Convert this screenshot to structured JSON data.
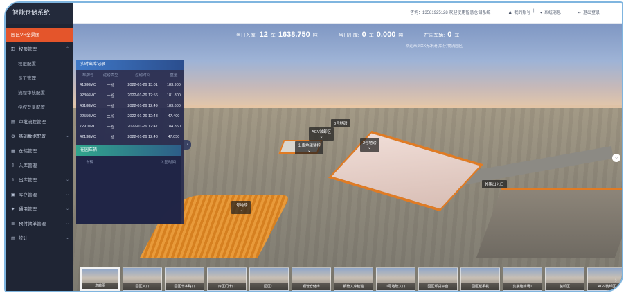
{
  "sidebar": {
    "title": "智能仓储系统",
    "items": [
      {
        "label": "园区VR全景图",
        "icon": "",
        "active": true,
        "sub": false
      },
      {
        "label": "权限管理",
        "icon": "key-icon",
        "sub": false,
        "chevron": "^"
      },
      {
        "label": "权限配置",
        "sub": true
      },
      {
        "label": "员工管理",
        "sub": true
      },
      {
        "label": "流程审核配置",
        "sub": true
      },
      {
        "label": "授权登录配置",
        "sub": true
      },
      {
        "label": "审批流程管理",
        "icon": "doc-icon",
        "sub": false
      },
      {
        "label": "基础数据配置",
        "icon": "gear-icon",
        "sub": false,
        "chevron": "v"
      },
      {
        "label": "仓储管理",
        "icon": "grid-icon",
        "sub": false
      },
      {
        "label": "入库管理",
        "icon": "inbox-icon",
        "sub": false
      },
      {
        "label": "出库管理",
        "icon": "outbox-icon",
        "sub": false,
        "chevron": "v"
      },
      {
        "label": "库存管理",
        "icon": "box-icon",
        "sub": false,
        "chevron": "v"
      },
      {
        "label": "通用管理",
        "icon": "tool-icon",
        "sub": false,
        "chevron": "v"
      },
      {
        "label": "预付款单管理",
        "icon": "list-icon",
        "sub": false,
        "chevron": "v"
      },
      {
        "label": "统计",
        "icon": "chart-icon",
        "sub": false,
        "chevron": "v"
      }
    ]
  },
  "topbar": {
    "phone": "咨询：13581925128 欢迎使用智慧仓储系统",
    "account": "我的账号",
    "separator": "|",
    "messages": "系统消息",
    "logout": "退出登录"
  },
  "stats": {
    "in_label": "当日入库:",
    "in_count": "12",
    "in_unit_vehicle": "车",
    "in_weight": "1638.750",
    "in_unit_weight": "吨",
    "out_label": "当日出库:",
    "out_count": "0",
    "out_unit_vehicle": "车",
    "out_weight": "0.000",
    "out_unit_weight": "吨",
    "park_label": "在园车辆:",
    "park_count": "0",
    "park_unit": "车",
    "welcome": "欢迎来到XX无水港(库存)物流园区"
  },
  "inbound_panel": {
    "title": "实时出库记录",
    "columns": [
      "车牌号",
      "过磅类型",
      "过磅时间",
      "重量"
    ],
    "rows": [
      [
        "41380MO",
        "一检",
        "2022-01-26 13:01",
        "183.900"
      ],
      [
        "92366MO",
        "一检",
        "2022-01-26 12:56",
        "181.800"
      ],
      [
        "43188MO",
        "一检",
        "2022-01-26 12:49",
        "183.600"
      ],
      [
        "22550MO",
        "二检",
        "2022-01-26 12:48",
        "47.400"
      ],
      [
        "72910MO",
        "一检",
        "2022-01-26 12:47",
        "184.850"
      ],
      [
        "42138MO",
        "二检",
        "2022-01-26 12:43",
        "47.050"
      ]
    ]
  },
  "outbound_panel": {
    "title": "在园车辆",
    "col_left": "车辆",
    "col_right": "入园时间"
  },
  "scene_labels": {
    "agv": "AGV装卸区",
    "gate3": "3号地磅",
    "gate2": "2号地磅",
    "exit_gate": "出库地磅监控",
    "gate1": "1号地磅",
    "outer_gate": "外围出入口"
  },
  "thumbnails": [
    "鸟瞰图",
    "园区入口",
    "园区十字路口",
    "库区门卡口",
    "园区厂",
    "钢管仓储库",
    "钢管入库检验",
    "1号地磅入口",
    "园区卸货平台",
    "园区起吊机",
    "集装箱堆场1",
    "装卸区",
    "AGV装卸区"
  ],
  "icons": {
    "collapse": "‹",
    "next": "›",
    "down_arrow": "⌄",
    "compass": "◎",
    "fullscreen": "⊙",
    "bubble": "○"
  }
}
